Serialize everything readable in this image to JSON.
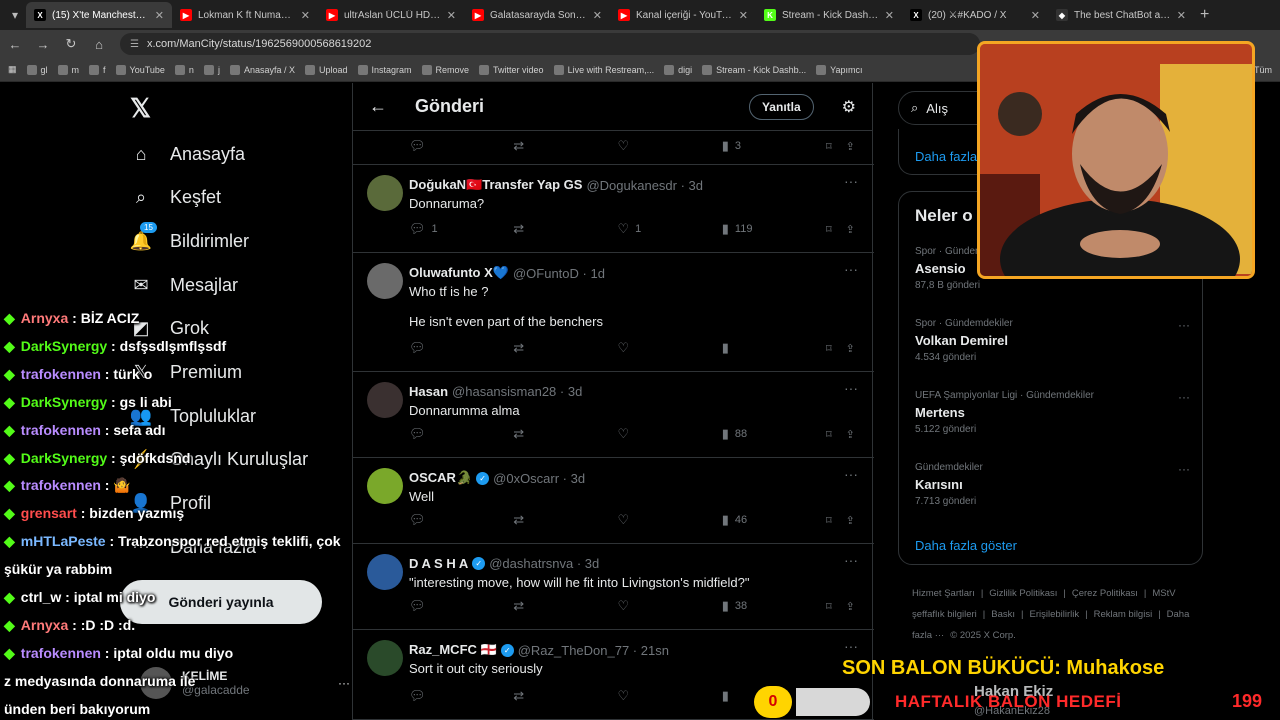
{
  "browser": {
    "tabs": [
      {
        "title": "(15) X'te Manchester City:",
        "favicon": "X",
        "color": "#000000",
        "active": true
      },
      {
        "title": "Lokman K ft Numan K - Y",
        "favicon": "▶",
        "color": "#ff0000"
      },
      {
        "title": "ultrAslan ÜCLÜ HD - YouT",
        "favicon": "▶",
        "color": "#ff0000"
      },
      {
        "title": "Galatasarayda Son Durum",
        "favicon": "▶",
        "color": "#ff0000"
      },
      {
        "title": "Kanal içeriği - YouTube St",
        "favicon": "▶",
        "color": "#ff0000"
      },
      {
        "title": "Stream - Kick Dashboard",
        "favicon": "K",
        "color": "#53fc18"
      },
      {
        "title": "(20) ⚔#KADO / X",
        "favicon": "X",
        "color": "#000000"
      },
      {
        "title": "The best ChatBot and Wi",
        "favicon": "◆",
        "color": "#333333"
      }
    ],
    "url": "x.com/ManCity/status/1962569000568619202",
    "bookmarks": [
      "gl",
      "m",
      "f",
      "YouTube",
      "n",
      "j",
      "Anasayfa / X",
      "Upload",
      "Instagram",
      "Remove",
      "Twitter video",
      "Live with Restream,...",
      "digi",
      "Stream - Kick Dashb...",
      "Yapımcı"
    ],
    "all_bookmarks": "Tüm"
  },
  "leftnav": {
    "items": [
      {
        "label": "Anasayfa",
        "icon": "home-icon",
        "glyph": "⌂"
      },
      {
        "label": "Keşfet",
        "icon": "search-icon",
        "glyph": "⌕"
      },
      {
        "label": "Bildirimler",
        "icon": "bell-icon",
        "glyph": "🔔",
        "badge": "15"
      },
      {
        "label": "Mesajlar",
        "icon": "mail-icon",
        "glyph": "✉"
      },
      {
        "label": "Grok",
        "icon": "grok-icon",
        "glyph": "◩"
      },
      {
        "label": "Premium",
        "icon": "x-premium-icon",
        "glyph": "𝕏"
      },
      {
        "label": "Topluluklar",
        "icon": "communities-icon",
        "glyph": "👥"
      },
      {
        "label": "Onaylı Kuruluşlar",
        "icon": "lightning-icon",
        "glyph": "⚡"
      },
      {
        "label": "Profil",
        "icon": "person-icon",
        "glyph": "👤"
      },
      {
        "label": "Daha fazla",
        "icon": "more-circle-icon",
        "glyph": "⋯"
      }
    ],
    "post_button": "Gönderi yayınla",
    "profile": {
      "name": "KELİME",
      "handle": "@galacadde"
    }
  },
  "main": {
    "title": "Gönderi",
    "reply_button": "Yanıtla",
    "top_actions": {
      "replies": "",
      "reposts": "",
      "likes": "",
      "views": "3"
    },
    "tweets": [
      {
        "name": "DoğukaN🇹🇷Transfer Yap GS",
        "handle": "@Dogukanesdr · 3d",
        "text": "Donnaruma?",
        "verified": false,
        "replies": "1",
        "reposts": "",
        "likes": "1",
        "views": "119",
        "avatar": "#5a6a3a"
      },
      {
        "name": "Oluwafunto X💙",
        "handle": "@OFuntoD · 1d",
        "text": "Who tf is he ?\n\nHe isn't even part of the benchers",
        "verified": false,
        "replies": "",
        "reposts": "",
        "likes": "",
        "views": "",
        "avatar": "#6a6a6a"
      },
      {
        "name": "Hasan",
        "handle": "@hasansisman28 · 3d",
        "text": "Donnarumma alma",
        "verified": false,
        "replies": "",
        "reposts": "",
        "likes": "",
        "views": "88",
        "avatar": "#3a3030"
      },
      {
        "name": "OSCAR🐊",
        "handle": "@0xOscarr · 3d",
        "text": "Well",
        "verified": true,
        "replies": "",
        "reposts": "",
        "likes": "",
        "views": "46",
        "avatar": "#7aa82a"
      },
      {
        "name": "D A S H A",
        "handle": "@dashatrsnva · 3d",
        "text": "\"interesting move, how will he fit into Livingston's midfield?\"",
        "verified": true,
        "replies": "",
        "reposts": "",
        "likes": "",
        "views": "38",
        "avatar": "#2a5a9a"
      },
      {
        "name": "Raz_MCFC 🏴󠁧󠁢󠁥󠁮󠁧󠁿",
        "handle": "@Raz_TheDon_77 · 21sn",
        "text": "Sort it out city seriously",
        "verified": true,
        "replies": "",
        "reposts": "",
        "likes": "",
        "views": "",
        "avatar": "#2a4a2a"
      }
    ]
  },
  "right": {
    "search_placeholder": "Alış",
    "show_more_top": "Daha fazla",
    "trends_title": "Neler o",
    "trends": [
      {
        "category": "Spor · Gündem",
        "name": "Asensio",
        "count": "87,8 B gönderi"
      },
      {
        "category": "Spor · Gündemdekiler",
        "name": "Volkan Demirel",
        "count": "4.534 gönderi"
      },
      {
        "category": "UEFA Şampiyonlar Ligi · Gündemdekiler",
        "name": "Mertens",
        "count": "5.122 gönderi"
      },
      {
        "category": "Gündemdekiler",
        "name": "Karısını",
        "count": "7.713 gönderi"
      }
    ],
    "show_more": "Daha fazla göster",
    "footer": [
      "Hizmet Şartları",
      "|",
      "Gizlilik Politikası",
      "|",
      "Çerez Politikası",
      "|",
      "MStV şeffaflık bilgileri",
      "|",
      "Baskı",
      "|",
      "Erişilebilirlik",
      "|",
      "Reklam bilgisi",
      "|",
      "Daha fazla ···",
      "© 2025 X Corp."
    ]
  },
  "chat": {
    "messages": [
      {
        "user": "Arnyxa",
        "color": "#ff7a7a",
        "text": "BİZ ACIZ"
      },
      {
        "user": "DarkSynergy",
        "color": "#53fc18",
        "text": "dsfşsdlşmflşsdf"
      },
      {
        "user": "trafokennen",
        "color": "#b98cff",
        "text": "türk o"
      },
      {
        "user": "DarkSynergy",
        "color": "#53fc18",
        "text": "gs li abi"
      },
      {
        "user": "trafokennen",
        "color": "#b98cff",
        "text": "sefa adı"
      },
      {
        "user": "DarkSynergy",
        "color": "#53fc18",
        "text": "şdöfkdsnd"
      },
      {
        "user": "trafokennen",
        "color": "#b98cff",
        "text": "🤷"
      },
      {
        "user": "grensart",
        "color": "#ff4d4d",
        "text": "bizden yazmış"
      },
      {
        "user": "mHTLaPeste",
        "color": "#7ab8ff",
        "text": "Trabzonspor red etmiş teklifi, çok"
      },
      {
        "user": "",
        "color": "#ffffff",
        "text": "şükür ya rabbim"
      },
      {
        "user": "ctrl_w",
        "color": "#ffffff",
        "text": "iptal mi diyo"
      },
      {
        "user": "Arnyxa",
        "color": "#ff7a7a",
        "text": ":D :D :d."
      },
      {
        "user": "trafokennen",
        "color": "#b98cff",
        "text": "iptal oldu mu diyo"
      },
      {
        "user": "",
        "color": "#ffffff",
        "text": "z medyasında donnaruma ile"
      },
      {
        "user": "",
        "color": "#ffffff",
        "text": "ünden beri bakıyorum"
      }
    ]
  },
  "overlay": {
    "balon_text": "SON BALON BÜKÜCÜ: Muhakose",
    "goal_current": "0",
    "goal_label": "HAFTALIK BALON HEDEFİ",
    "goal_target": "199",
    "goal_progress": 0,
    "bottom_name": "Hakan Ekiz",
    "bottom_handle": "@HakanEkiz28"
  }
}
